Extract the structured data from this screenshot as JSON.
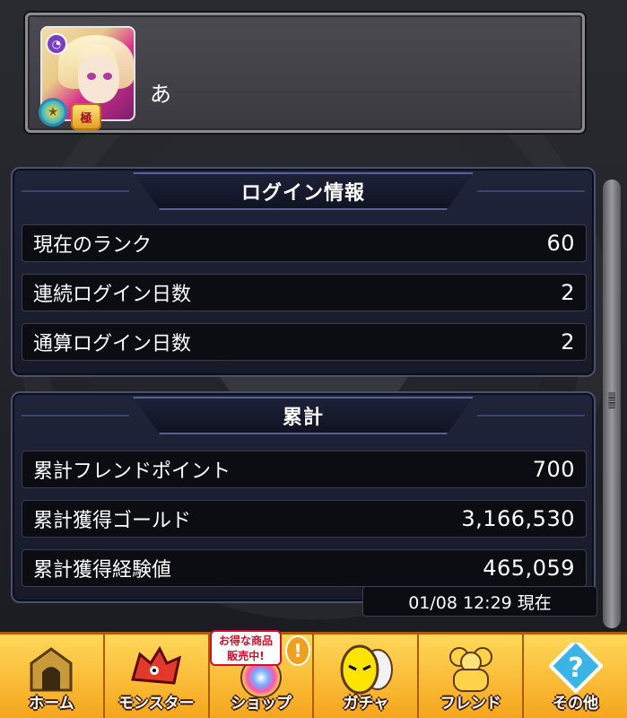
{
  "profile": {
    "player_name": "あ",
    "badge_top_icon": "clock-badge-icon",
    "badge_rank_text": "極"
  },
  "login_panel": {
    "title": "ログイン情報",
    "rows": [
      {
        "label": "現在のランク",
        "value": "60"
      },
      {
        "label": "連続ログイン日数",
        "value": "2"
      },
      {
        "label": "通算ログイン日数",
        "value": "2"
      }
    ]
  },
  "total_panel": {
    "title": "累計",
    "rows": [
      {
        "label": "累計フレンドポイント",
        "value": "700"
      },
      {
        "label": "累計獲得ゴールド",
        "value": "3,166,530"
      },
      {
        "label": "累計獲得経験値",
        "value": "465,059"
      }
    ],
    "timestamp": "01/08 12:29 現在"
  },
  "bottom_nav": {
    "items": [
      {
        "label": "ホーム",
        "icon": "home-gate-icon"
      },
      {
        "label": "モンスター",
        "icon": "monster-icon"
      },
      {
        "label": "ショップ",
        "icon": "shop-orb-icon"
      },
      {
        "label": "ガチャ",
        "icon": "gacha-egg-icon"
      },
      {
        "label": "フレンド",
        "icon": "friend-icon"
      },
      {
        "label": "その他",
        "icon": "question-icon"
      }
    ],
    "shop_badge": "お得な商品\n販売中!",
    "shop_badge_line1": "お得な商品",
    "shop_badge_line2": "販売中!",
    "shop_alert": "!"
  },
  "colors": {
    "nav_background": "#f5a51c",
    "panel_background": "#1a1d2c",
    "accent_cyan": "#3aa9c9"
  }
}
